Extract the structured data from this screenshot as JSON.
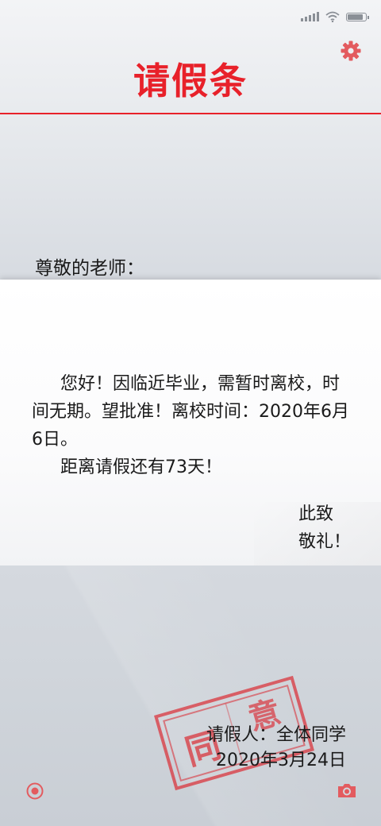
{
  "colors": {
    "accent": "#e8212a",
    "icon_red": "#e35b5f",
    "stamp_red": "#d9363e",
    "status_gray": "#8a8f96"
  },
  "status_bar": {
    "icons": [
      "signal-icon",
      "wifi-icon",
      "battery-icon"
    ]
  },
  "header": {
    "title": "请假条",
    "settings_icon": "gear-icon"
  },
  "letter": {
    "salutation": "尊敬的老师：",
    "body_line1": "您好！因临近毕业，需暂时离校，时间无期。望批准！离校时间：2020年6月6日。",
    "body_line2": "距离请假还有73天！",
    "closing_1": "此致",
    "closing_2": "敬礼！",
    "signature_name": "请假人：全体同学",
    "signature_date": "2020年3月24日"
  },
  "stamp": {
    "text": "同意",
    "icon": "stamp-icon"
  },
  "footer": {
    "left_icon": "record-icon",
    "right_icon": "camera-icon"
  }
}
